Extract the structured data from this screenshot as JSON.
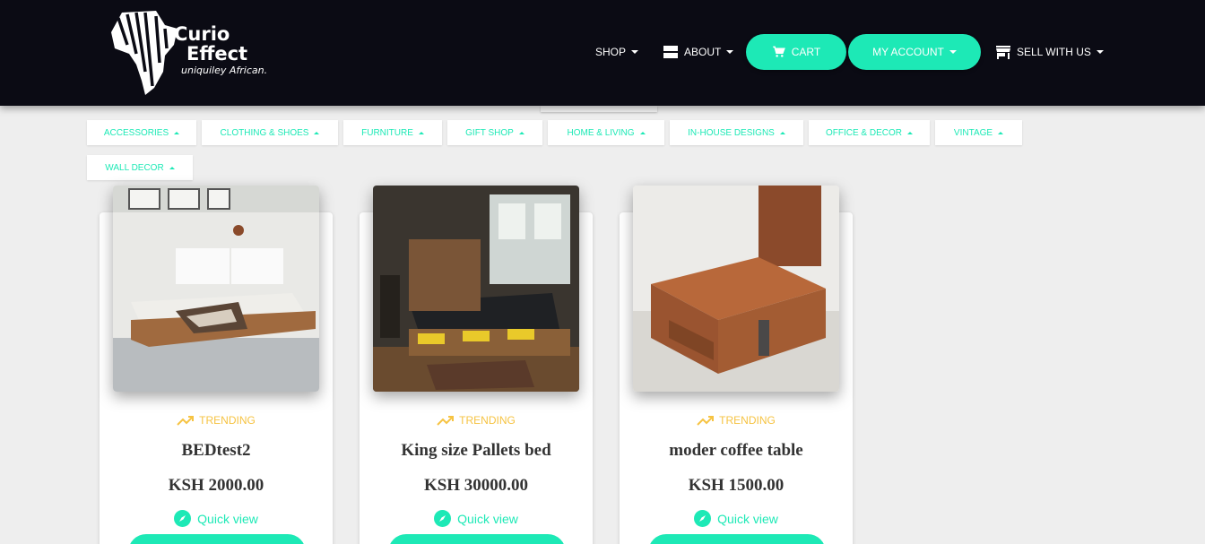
{
  "brand": {
    "name_line1": "Curio",
    "name_line2": "Effect",
    "tagline": "uniquiley African."
  },
  "nav": {
    "shop": "SHOP",
    "about": "ABOUT",
    "cart": "CART",
    "my_account": "MY ACCOUNT",
    "sell": "SELL WITH US"
  },
  "categories": [
    "ACCESSORIES",
    "CLOTHING & SHOES",
    "FURNITURE",
    "GIFT SHOP",
    "HOME & LIVING",
    "IN-HOUSE DESIGNS",
    "OFFICE & DECOR",
    "VINTAGE",
    "WALL DECOR"
  ],
  "products": [
    {
      "badge": "TRENDING",
      "title": "BEDtest2",
      "price": "KSH 2000.00",
      "quick_view": "Quick view"
    },
    {
      "badge": "TRENDING",
      "title": "King size Pallets bed",
      "price": "KSH 30000.00",
      "quick_view": "Quick view"
    },
    {
      "badge": "TRENDING",
      "title": "moder coffee table",
      "price": "KSH 1500.00",
      "quick_view": "Quick view"
    }
  ],
  "colors": {
    "accent": "#1de9b6",
    "trending": "#f6c342",
    "header_bg": "#0b0b14",
    "page_bg": "#eeeeee"
  }
}
